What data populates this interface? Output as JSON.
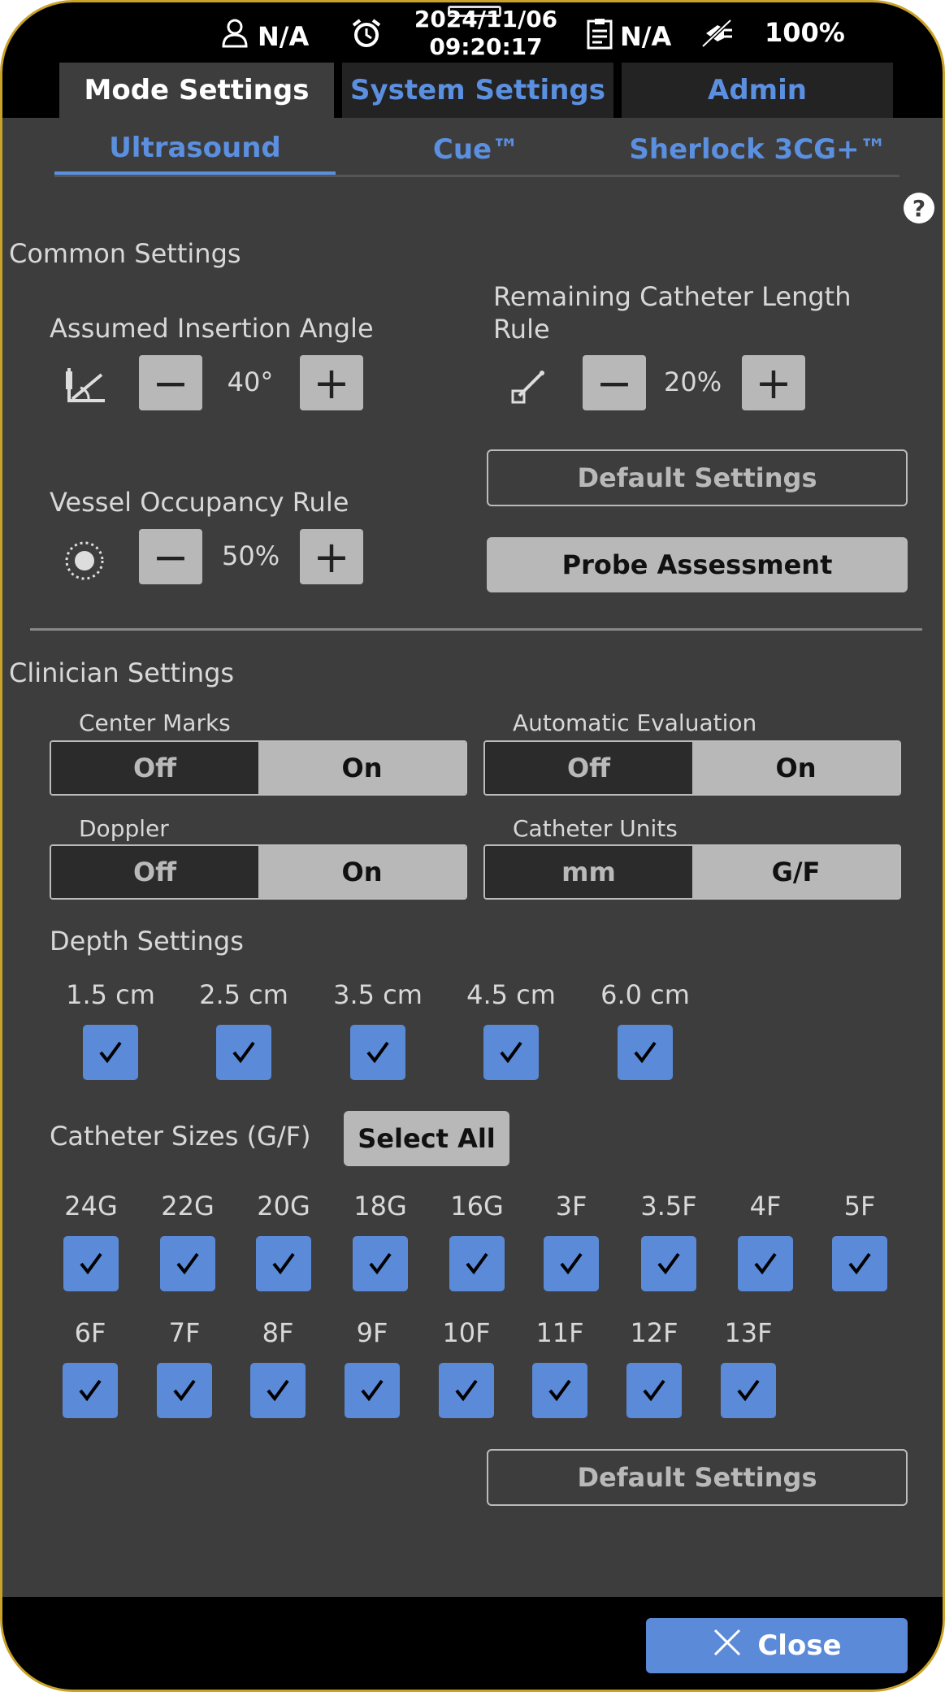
{
  "status": {
    "user": "N/A",
    "date": "2024/11/06",
    "time": "09:20:17",
    "patient": "N/A",
    "battery": "100%"
  },
  "tabs": [
    {
      "label": "Mode Settings",
      "active": true
    },
    {
      "label": "System Settings",
      "active": false
    },
    {
      "label": "Admin",
      "active": false
    }
  ],
  "subtabs": [
    {
      "label": "Ultrasound",
      "active": true
    },
    {
      "label": "Cue™",
      "active": false
    },
    {
      "label": "Sherlock 3CG+™",
      "active": false
    }
  ],
  "help": "?",
  "common": {
    "title": "Common Settings",
    "insertion_angle": {
      "label": "Assumed Insertion Angle",
      "value": "40°"
    },
    "remaining_length": {
      "label": "Remaining Catheter Length Rule",
      "value": "20%"
    },
    "vessel_occupancy": {
      "label": "Vessel Occupancy Rule",
      "value": "50%"
    },
    "default_label": "Default Settings",
    "probe_label": "Probe Assessment"
  },
  "clinician": {
    "title": "Clinician Settings",
    "center_marks": {
      "label": "Center Marks",
      "off": "Off",
      "on": "On",
      "selected": "On"
    },
    "auto_eval": {
      "label": "Automatic Evaluation",
      "off": "Off",
      "on": "On",
      "selected": "On"
    },
    "doppler": {
      "label": "Doppler",
      "off": "Off",
      "on": "On",
      "selected": "On"
    },
    "catheter_units": {
      "label": "Catheter Units",
      "off": "mm",
      "on": "G/F",
      "selected": "G/F"
    },
    "depth_title": "Depth Settings",
    "depths": [
      "1.5 cm",
      "2.5 cm",
      "3.5 cm",
      "4.5 cm",
      "6.0 cm"
    ],
    "sizes_title": "Catheter Sizes (G/F)",
    "select_all": "Select All",
    "sizes_row1": [
      "24G",
      "22G",
      "20G",
      "18G",
      "16G",
      "3F",
      "3.5F",
      "4F",
      "5F"
    ],
    "sizes_row2": [
      "6F",
      "7F",
      "8F",
      "9F",
      "10F",
      "11F",
      "12F",
      "13F"
    ],
    "default_label": "Default Settings"
  },
  "close_label": "Close",
  "colors": {
    "accent": "#5b8ad8",
    "panel": "#3d3d3d",
    "button": "#b8b8b8"
  }
}
